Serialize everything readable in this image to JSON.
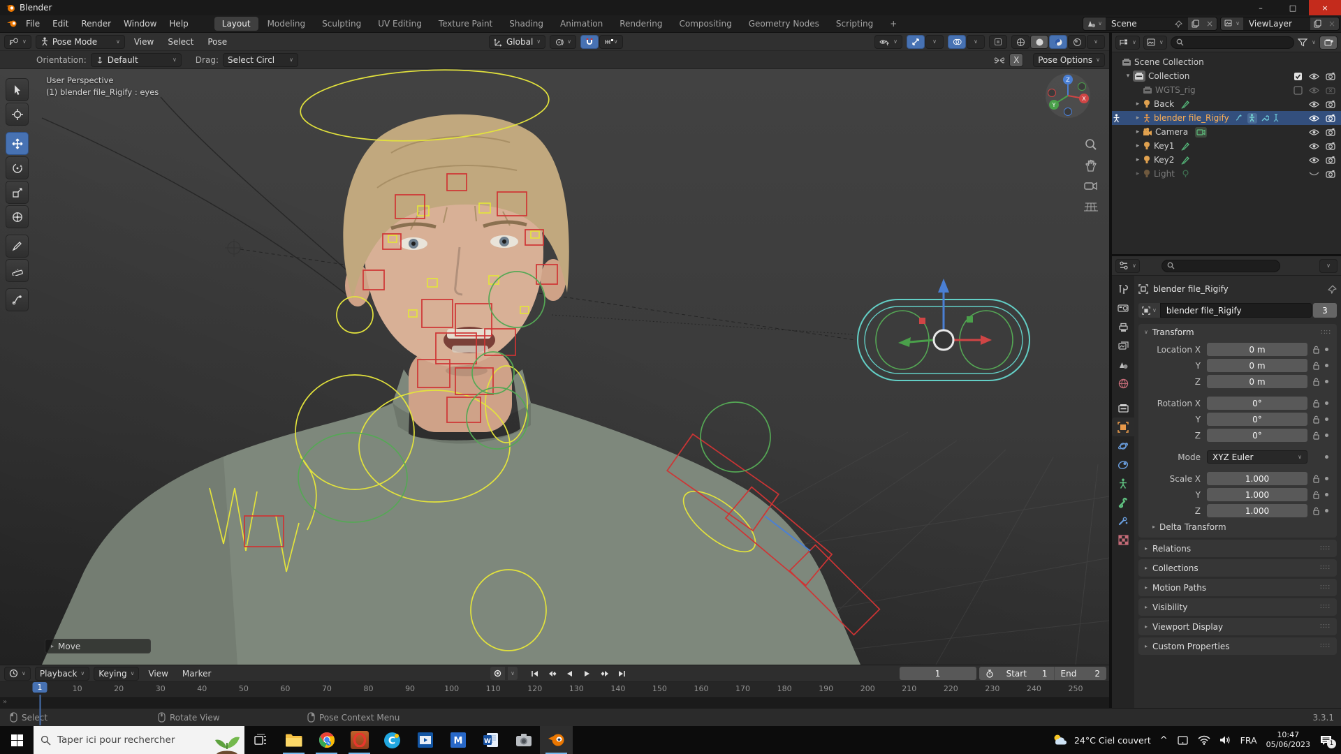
{
  "icons": {
    "chevron_down": "∨",
    "triangle_right": "▸",
    "triangle_down": "▾",
    "check": "✓",
    "close": "×",
    "minimize": "–",
    "maximize": "□",
    "plus": "+",
    "drag_dots": "∷∷",
    "chevron_up": "^",
    "scroll_more": "»"
  },
  "window": {
    "title": "Blender"
  },
  "topbar": {
    "menus": [
      "File",
      "Edit",
      "Render",
      "Window",
      "Help"
    ],
    "tabs": [
      "Layout",
      "Modeling",
      "Sculpting",
      "UV Editing",
      "Texture Paint",
      "Shading",
      "Animation",
      "Rendering",
      "Compositing",
      "Geometry Nodes",
      "Scripting"
    ],
    "active_tab": "Layout",
    "scene_name": "Scene",
    "viewlayer_name": "ViewLayer"
  },
  "viewport_header": {
    "mode": "Pose Mode",
    "menus": [
      "View",
      "Select",
      "Pose"
    ],
    "orientation": "Global",
    "row2": {
      "orientation_label": "Orientation:",
      "orientation_value": "Default",
      "drag_label": "Drag:",
      "drag_value": "Select Circl",
      "mirror_x": "X",
      "pose_options": "Pose Options"
    }
  },
  "viewport": {
    "view_label": "User Perspective",
    "object_label": "(1) blender file_Rigify : eyes",
    "operator_panel": "Move",
    "gizmo_axes": {
      "x": "X",
      "y": "Y",
      "z": "Z"
    }
  },
  "outliner": {
    "rows": [
      {
        "label": "Scene Collection"
      },
      {
        "label": "Collection"
      },
      {
        "label": "WGTS_rig"
      },
      {
        "label": "Back"
      },
      {
        "label": "blender file_Rigify"
      },
      {
        "label": "Camera"
      },
      {
        "label": "Key1"
      },
      {
        "label": "Key2"
      },
      {
        "label": "Light"
      }
    ]
  },
  "properties": {
    "breadcrumb": "blender file_Rigify",
    "name_field": "blender file_Rigify",
    "users_count": "3",
    "transform": {
      "title": "Transform",
      "rows": [
        {
          "label": "Location X",
          "value": "0 m"
        },
        {
          "label": "Y",
          "value": "0 m"
        },
        {
          "label": "Z",
          "value": "0 m"
        },
        {
          "label": "Rotation X",
          "value": "0°"
        },
        {
          "label": "Y",
          "value": "0°"
        },
        {
          "label": "Z",
          "value": "0°"
        },
        {
          "label": "Mode",
          "value": "XYZ Euler"
        },
        {
          "label": "Scale X",
          "value": "1.000"
        },
        {
          "label": "Y",
          "value": "1.000"
        },
        {
          "label": "Z",
          "value": "1.000"
        }
      ],
      "delta": "Delta Transform"
    },
    "panels": [
      "Relations",
      "Collections",
      "Motion Paths",
      "Visibility",
      "Viewport Display",
      "Custom Properties"
    ]
  },
  "timeline": {
    "menus": [
      "Playback",
      "Keying",
      "View",
      "Marker"
    ],
    "current_frame": 1,
    "current_frame_label": "1",
    "start_label": "Start",
    "start_value": "1",
    "end_label": "End",
    "end_value": "2",
    "ticks": [
      10,
      20,
      30,
      40,
      50,
      60,
      70,
      80,
      90,
      100,
      110,
      120,
      130,
      140,
      150,
      160,
      170,
      180,
      190,
      200,
      210,
      220,
      230,
      240,
      250
    ]
  },
  "statusbar": {
    "items": [
      {
        "button": "left",
        "label": "Select"
      },
      {
        "button": "middle",
        "label": "Rotate View"
      },
      {
        "button": "right",
        "label": "Pose Context Menu"
      }
    ],
    "version": "3.3.1"
  },
  "taskbar": {
    "search_placeholder": "Taper ici pour rechercher",
    "tray": {
      "temperature": "24°C",
      "condition": "Ciel couvert",
      "language": "FRA",
      "time": "10:47",
      "date": "05/06/2023",
      "notification_count": "1"
    }
  },
  "colors": {
    "accent": "#4772b3",
    "selection": "#334f7d",
    "active_object_text": "#ffb054",
    "rig_yellow": "#e3e33c",
    "rig_red": "#cf3434",
    "rig_green": "#55a855",
    "rig_cyan": "#63cfc6",
    "close_button": "#c42b1c"
  }
}
